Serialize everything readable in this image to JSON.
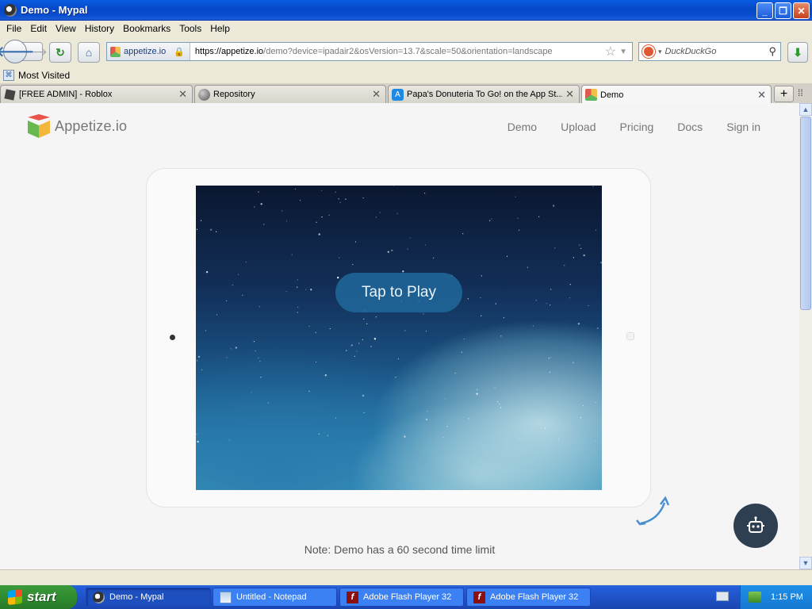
{
  "window": {
    "title": "Demo - Mypal",
    "buttons": {
      "minimize": "_",
      "maximize": "❐",
      "close": "✕"
    }
  },
  "menu": [
    "File",
    "Edit",
    "View",
    "History",
    "Bookmarks",
    "Tools",
    "Help"
  ],
  "navbar": {
    "site_identity": "appetize.io",
    "url_host": "https://appetize.io",
    "url_rest": "/demo?device=ipadair2&osVersion=13.7&scale=50&orientation=landscape",
    "search_placeholder": "DuckDuckGo"
  },
  "bookmarks": {
    "most_visited": "Most Visited"
  },
  "tabs": [
    {
      "label": "[FREE ADMIN] - Roblox",
      "icon": "roblox-icon"
    },
    {
      "label": "Repository",
      "icon": "globe-icon"
    },
    {
      "label": "Papa's Donuteria To Go! on the App St...",
      "icon": "app-store-icon"
    },
    {
      "label": "Demo",
      "icon": "appetize-icon",
      "active": true
    }
  ],
  "page": {
    "brand": "Appetize.io",
    "nav": [
      "Demo",
      "Upload",
      "Pricing",
      "Docs",
      "Sign in"
    ],
    "play_button": "Tap to Play",
    "note": "Note: Demo has a 60 second time limit"
  },
  "taskbar": {
    "start": "start",
    "tasks": [
      {
        "label": "Demo - Mypal",
        "icon": "mypal-icon",
        "active": true
      },
      {
        "label": "Untitled - Notepad",
        "icon": "notepad-icon"
      },
      {
        "label": "Adobe Flash Player 32",
        "icon": "flash-icon"
      },
      {
        "label": "Adobe Flash Player 32",
        "icon": "flash-icon"
      }
    ],
    "clock": "1:15 PM"
  },
  "colors": {
    "brand_red": "#e8534a",
    "brand_green": "#67b84f",
    "brand_yellow": "#f2b63a",
    "fab": "#2f3f52",
    "xp_blue": "#245edb"
  }
}
